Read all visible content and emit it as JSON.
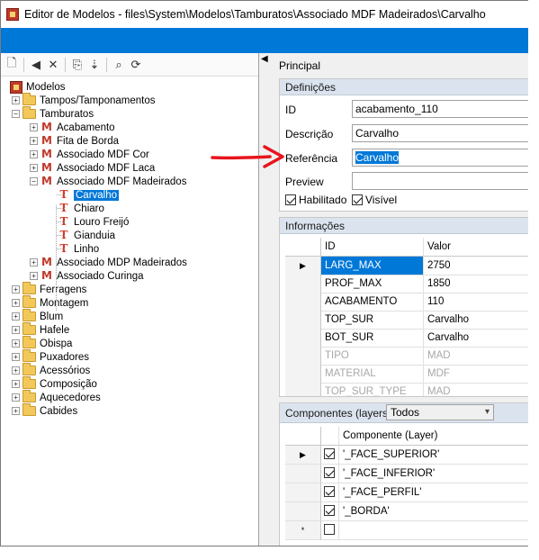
{
  "window": {
    "title": "Editor de Modelos - files\\System\\Modelos\\Tamburatos\\Associado MDF Madeirados\\Carvalho"
  },
  "toolbar": {
    "icons": [
      "new-icon",
      "back-icon",
      "delete-icon",
      "copy-icon",
      "move-icon",
      "find-icon",
      "refresh-icon"
    ],
    "glyphs": [
      "🗋",
      "◀",
      "✕",
      "⎘",
      "⇣",
      "⌕",
      "⟳"
    ]
  },
  "tree": {
    "root": "Modelos",
    "nodes": [
      {
        "label": "Tampos/Tamponamentos",
        "type": "folder",
        "expander": "+"
      },
      {
        "label": "Tamburatos",
        "type": "folder",
        "expander": "−"
      },
      {
        "label": "Acabamento",
        "type": "model",
        "expander": "+"
      },
      {
        "label": "Fita de Borda",
        "type": "model",
        "expander": "+"
      },
      {
        "label": "Associado MDF Cor",
        "type": "model",
        "expander": "+"
      },
      {
        "label": "Associado MDF Laca",
        "type": "model",
        "expander": "+"
      },
      {
        "label": "Associado MDF Madeirados",
        "type": "model",
        "expander": "−"
      },
      {
        "label": "Carvalho",
        "type": "leaf",
        "selected": true
      },
      {
        "label": "Chiaro",
        "type": "leaf"
      },
      {
        "label": "Louro Freijó",
        "type": "leaf"
      },
      {
        "label": "Gianduia",
        "type": "leaf"
      },
      {
        "label": "Linho",
        "type": "leaf"
      },
      {
        "label": "Associado MDP Madeirados",
        "type": "model",
        "expander": "+"
      },
      {
        "label": "Associado Curinga",
        "type": "model",
        "expander": "+"
      },
      {
        "label": "Ferragens",
        "type": "folder",
        "expander": "+"
      },
      {
        "label": "Montagem",
        "type": "folder",
        "expander": "+"
      },
      {
        "label": "Blum",
        "type": "folder",
        "expander": "+"
      },
      {
        "label": "Hafele",
        "type": "folder",
        "expander": "+"
      },
      {
        "label": "Obispa",
        "type": "folder",
        "expander": "+"
      },
      {
        "label": "Puxadores",
        "type": "folder",
        "expander": "+"
      },
      {
        "label": "Acessórios",
        "type": "folder",
        "expander": "+"
      },
      {
        "label": "Composição",
        "type": "folder",
        "expander": "+"
      },
      {
        "label": "Aquecedores",
        "type": "folder",
        "expander": "+"
      },
      {
        "label": "Cabides",
        "type": "folder",
        "expander": "+"
      }
    ]
  },
  "principal": {
    "label": "Principal",
    "collapse_glyph": "◀"
  },
  "definicoes": {
    "header": "Definições",
    "id_label": "ID",
    "id_value": "acabamento_110",
    "descricao_label": "Descrição",
    "descricao_value": "Carvalho",
    "referencia_label": "Referência",
    "referencia_value": "Carvalho",
    "preview_label": "Preview",
    "preview_value": "",
    "habilitado_label": "Habilitado",
    "habilitado_checked": true,
    "visivel_label": "Visível",
    "visivel_checked": true
  },
  "informacoes": {
    "header": "Informações",
    "columns": [
      "ID",
      "Valor"
    ],
    "current_row_glyph": "▶",
    "rows": [
      {
        "id": "LARG_MAX",
        "valor": "2750",
        "selected": true
      },
      {
        "id": "PROF_MAX",
        "valor": "1850"
      },
      {
        "id": "ACABAMENTO",
        "valor": "110"
      },
      {
        "id": "TOP_SUR",
        "valor": "Carvalho"
      },
      {
        "id": "BOT_SUR",
        "valor": "Carvalho"
      },
      {
        "id": "TIPO",
        "valor": "MAD",
        "dim": true
      },
      {
        "id": "MATERIAL",
        "valor": "MDF",
        "dim": true
      },
      {
        "id": "TOP_SUR_TYPE",
        "valor": "MAD",
        "dim": true
      }
    ]
  },
  "componentes": {
    "header": "Componentes (layers)",
    "filter_value": "Todos",
    "filter_glyph": "▾",
    "column": "Componente (Layer)",
    "current_row_glyph": "▶",
    "new_row_glyph": "*",
    "rows": [
      {
        "checked": true,
        "name": "'_FACE_SUPERIOR'"
      },
      {
        "checked": true,
        "name": "'_FACE_INFERIOR'"
      },
      {
        "checked": true,
        "name": "'_FACE_PERFIL'"
      },
      {
        "checked": true,
        "name": "'_BORDA'"
      },
      {
        "checked": false,
        "name": ""
      }
    ]
  },
  "colors": {
    "accent": "#0078d7",
    "annotation": "#e8141c",
    "section_header": "#dbe4ee"
  }
}
